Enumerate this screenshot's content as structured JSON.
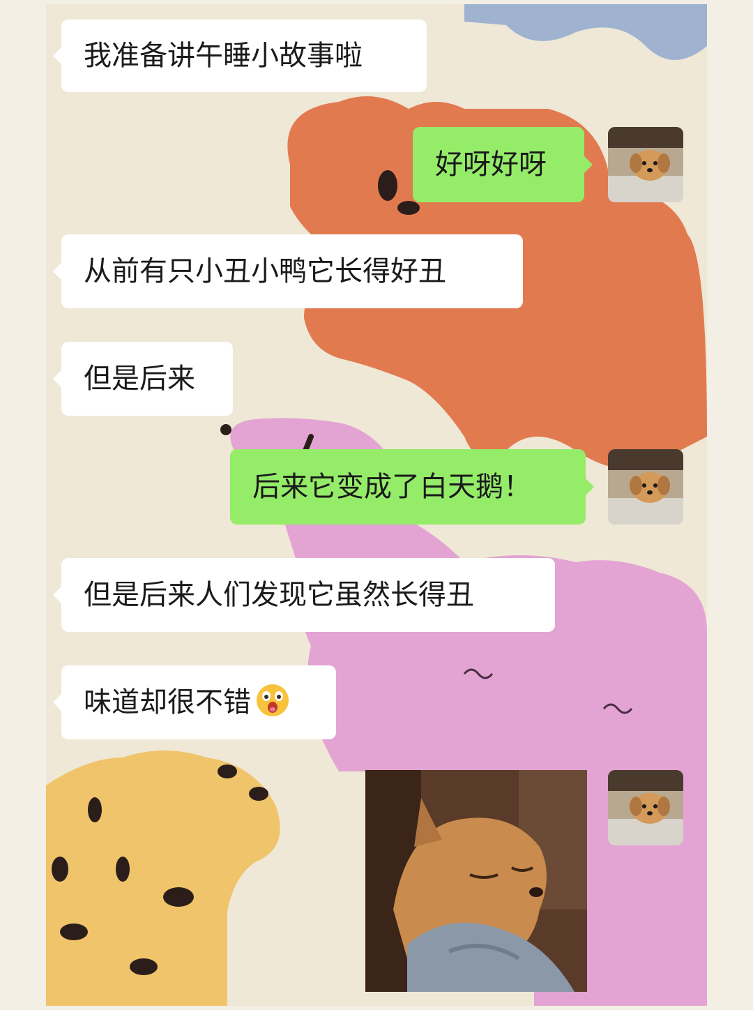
{
  "chat": {
    "messages": [
      {
        "side": "left",
        "text": "我准备讲午睡小故事啦"
      },
      {
        "side": "right",
        "text": "好呀好呀"
      },
      {
        "side": "left",
        "text": "从前有只小丑小鸭它长得好丑"
      },
      {
        "side": "left",
        "text": "但是后来"
      },
      {
        "side": "right",
        "text": "后来它变成了白天鹅！"
      },
      {
        "side": "left",
        "text": "但是后来人们发现它虽然长得丑"
      },
      {
        "side": "left",
        "text": "味道却很不错",
        "emoji": "astonished-face-emoji"
      },
      {
        "side": "right",
        "type": "image",
        "content": "sleeping-shiba-dog-photo"
      }
    ],
    "self_avatar": "puppy-under-bed-photo",
    "wallpaper": "cartoon-dogs-illustration"
  },
  "colors": {
    "bubble_self": "#95ec69",
    "bubble_other": "#ffffff",
    "background": "#efe8d6"
  }
}
